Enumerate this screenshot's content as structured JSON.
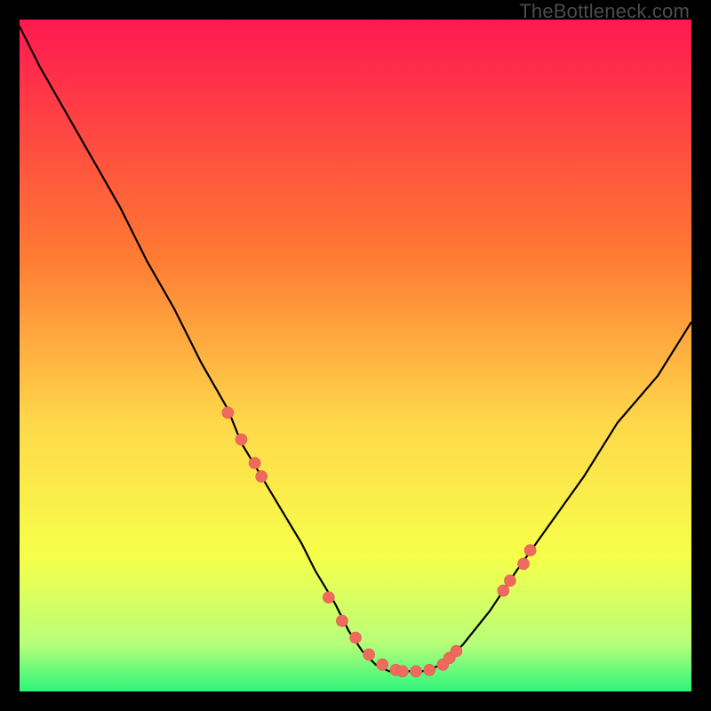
{
  "watermark": "TheBottleneck.com",
  "colors": {
    "gradient_top": "#ff1850",
    "gradient_mid1": "#ff7a33",
    "gradient_mid2": "#ffd84a",
    "gradient_mid3": "#f6ff4a",
    "gradient_mid4": "#b6ff7a",
    "gradient_bot": "#2cf57a",
    "frame": "#000000",
    "curve_stroke": "#000000",
    "marker_fill": "#ee6a5f",
    "marker_stroke": "#e05a50"
  },
  "chart_data": {
    "type": "line",
    "title": "",
    "xlabel": "",
    "ylabel": "",
    "xlim": [
      0,
      100
    ],
    "ylim": [
      0,
      100
    ],
    "grid": false,
    "legend": false,
    "series": [
      {
        "name": "bottleneck-curve",
        "x": [
          0,
          3,
          7,
          11,
          15,
          19,
          23,
          27,
          31,
          33,
          36,
          39,
          42,
          44,
          47,
          49,
          51,
          53,
          55,
          58,
          60,
          63,
          66,
          70,
          74,
          79,
          84,
          89,
          95,
          100
        ],
        "y": [
          99,
          93,
          86,
          79,
          72,
          64,
          57,
          49,
          42,
          37,
          32,
          27,
          22,
          18,
          13,
          9,
          6,
          4,
          3,
          3,
          3,
          4,
          7,
          12,
          18,
          25,
          32,
          40,
          47,
          55
        ]
      }
    ],
    "markers": {
      "name": "highlight-points",
      "x": [
        31,
        33,
        35,
        36,
        46,
        48,
        50,
        52,
        54,
        56,
        57,
        59,
        61,
        63,
        64,
        65,
        72,
        73,
        75,
        76
      ],
      "y": [
        41.5,
        37.5,
        34,
        32,
        14,
        10.5,
        8,
        5.5,
        4,
        3.2,
        3,
        3,
        3.2,
        4,
        5,
        6,
        15,
        16.5,
        19,
        21
      ]
    }
  }
}
